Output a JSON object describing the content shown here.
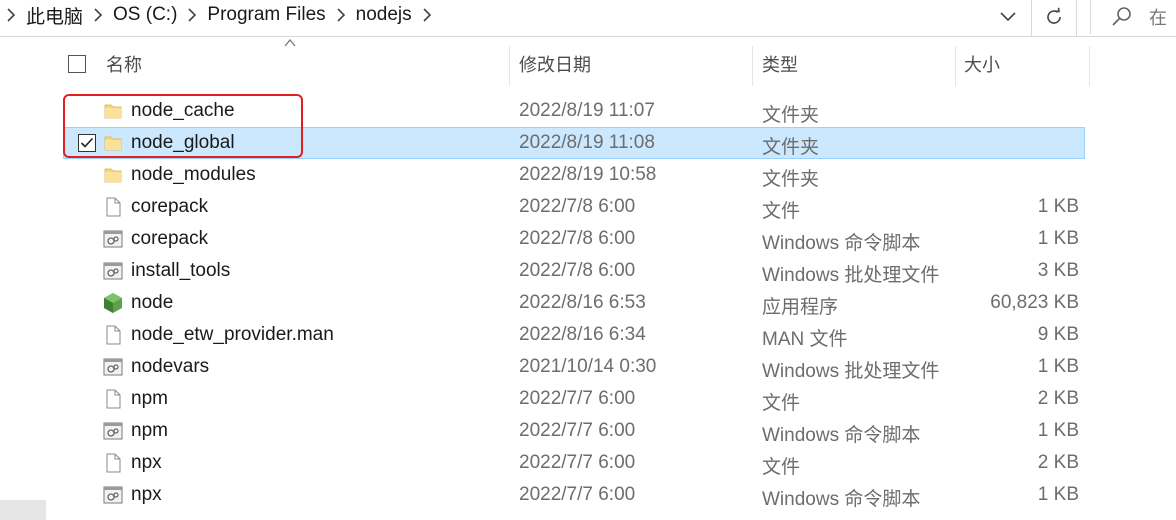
{
  "address_bar": {
    "crumbs": [
      "此电脑",
      "OS (C:)",
      "Program Files",
      "nodejs"
    ],
    "search_placeholder": "在"
  },
  "columns": {
    "name": "名称",
    "date": "修改日期",
    "type": "类型",
    "size": "大小"
  },
  "rows": [
    {
      "name": "node_cache",
      "date": "2022/8/19 11:07",
      "type": "文件夹",
      "size": "",
      "icon": "folder-icon"
    },
    {
      "name": "node_global",
      "date": "2022/8/19 11:08",
      "type": "文件夹",
      "size": "",
      "icon": "folder-icon",
      "selected": true,
      "checked": true
    },
    {
      "name": "node_modules",
      "date": "2022/8/19 10:58",
      "type": "文件夹",
      "size": "",
      "icon": "folder-icon"
    },
    {
      "name": "corepack",
      "date": "2022/7/8 6:00",
      "type": "文件",
      "size": "1 KB",
      "icon": "file-icon"
    },
    {
      "name": "corepack",
      "date": "2022/7/8 6:00",
      "type": "Windows 命令脚本",
      "size": "1 KB",
      "icon": "script-icon"
    },
    {
      "name": "install_tools",
      "date": "2022/7/8 6:00",
      "type": "Windows 批处理文件",
      "size": "3 KB",
      "icon": "script-icon"
    },
    {
      "name": "node",
      "date": "2022/8/16 6:53",
      "type": "应用程序",
      "size": "60,823 KB",
      "icon": "node-app-icon"
    },
    {
      "name": "node_etw_provider.man",
      "date": "2022/8/16 6:34",
      "type": "MAN 文件",
      "size": "9 KB",
      "icon": "file-icon"
    },
    {
      "name": "nodevars",
      "date": "2021/10/14 0:30",
      "type": "Windows 批处理文件",
      "size": "1 KB",
      "icon": "script-icon"
    },
    {
      "name": "npm",
      "date": "2022/7/7 6:00",
      "type": "文件",
      "size": "2 KB",
      "icon": "file-icon"
    },
    {
      "name": "npm",
      "date": "2022/7/7 6:00",
      "type": "Windows 命令脚本",
      "size": "1 KB",
      "icon": "script-icon"
    },
    {
      "name": "npx",
      "date": "2022/7/7 6:00",
      "type": "文件",
      "size": "2 KB",
      "icon": "file-icon"
    },
    {
      "name": "npx",
      "date": "2022/7/7 6:00",
      "type": "Windows 命令脚本",
      "size": "1 KB",
      "icon": "script-icon"
    }
  ],
  "colors": {
    "selection_bg": "#cce8ff",
    "selection_border": "#99d1ff",
    "highlight": "#e02020",
    "folder": "#f8d775"
  }
}
